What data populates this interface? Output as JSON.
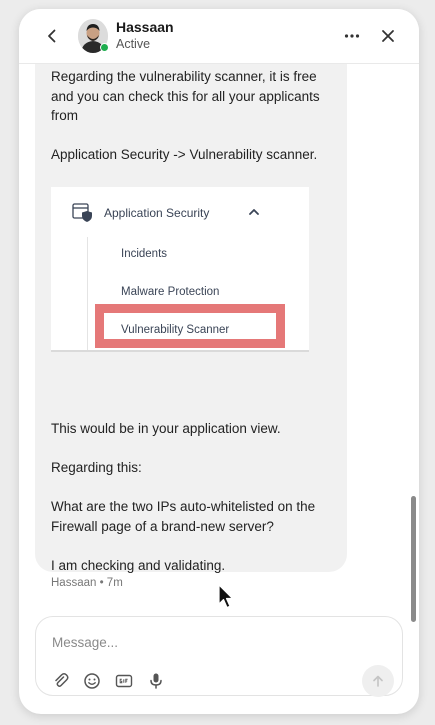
{
  "header": {
    "user_name": "Hassaan",
    "user_status": "Active"
  },
  "message": {
    "lines_top": [
      "Regarding the vulnerability scanner, it is free",
      "and you can check this for all your applicants",
      "from"
    ],
    "path_line": "Application Security -> Vulnerability scanner.",
    "after_image": "This would be in your application view.",
    "regarding": "Regarding this:",
    "question_line1": "What are the two IPs auto-whitelisted on the",
    "question_line2": "Firewall page of a brand-new server?",
    "closing": "I am checking and validating.",
    "meta": "Hassaan • 7m"
  },
  "embed": {
    "app_title": "Application Security",
    "items": [
      "Incidents",
      "Malware Protection",
      "Vulnerability Scanner"
    ],
    "highlight_color": "#e57878"
  },
  "composer": {
    "placeholder": "Message..."
  },
  "icons": {
    "back": "chevron-left-icon",
    "more": "more-horizontal-icon",
    "close": "close-icon",
    "attach": "paperclip-icon",
    "emoji": "emoji-icon",
    "gif": "gif-icon",
    "mic": "microphone-icon",
    "send": "arrow-up-icon"
  },
  "colors": {
    "status_online": "#1fae4f",
    "bubble_bg": "#f1f1f1"
  }
}
